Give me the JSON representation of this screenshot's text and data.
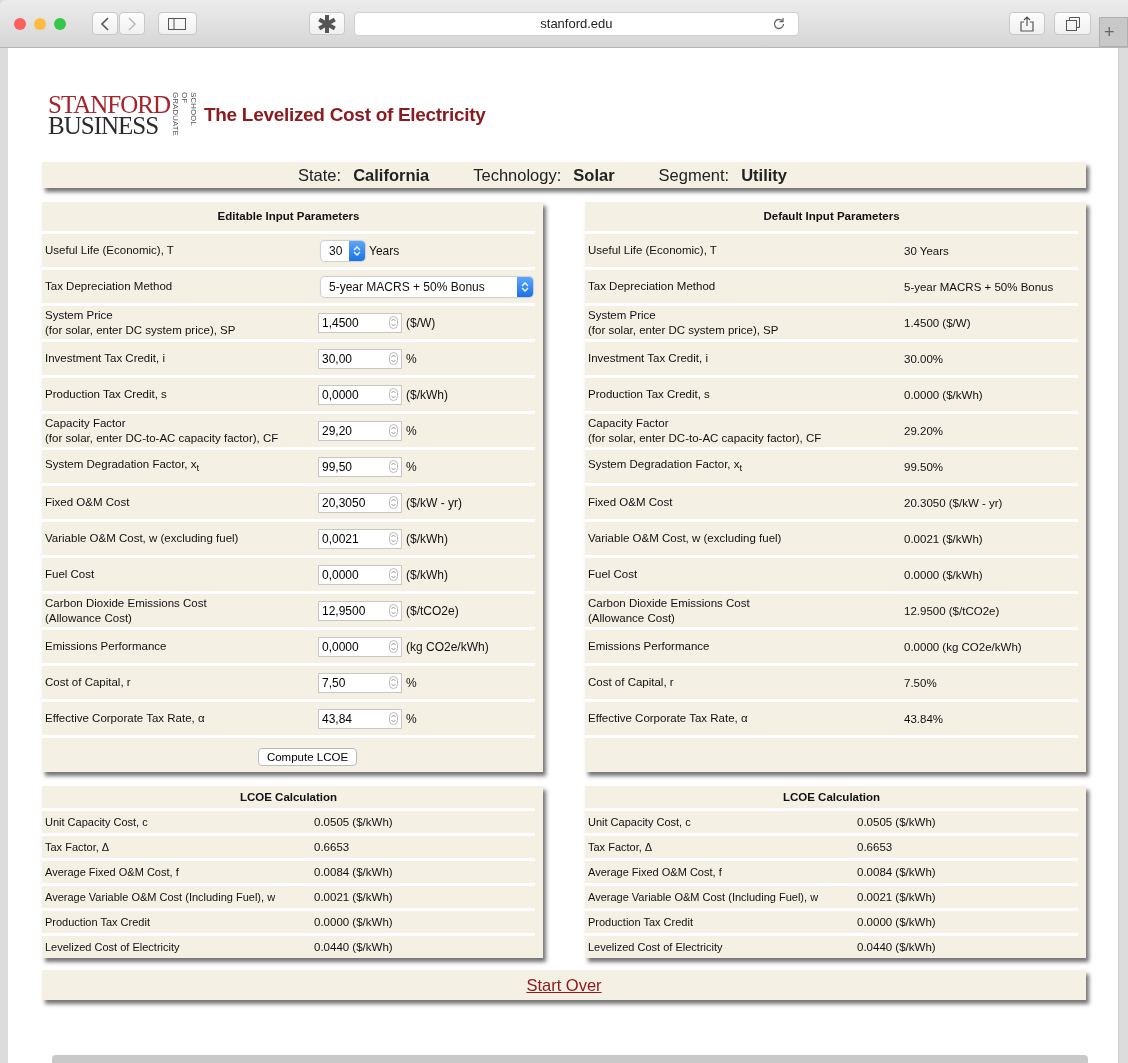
{
  "browser": {
    "url": "stanford.edu",
    "new_tab": "+"
  },
  "logo": {
    "line1": "STANFORD",
    "line2": "BUSINESS",
    "side1": "GRADUATE",
    "side2": "SCHOOL OF"
  },
  "title": "The Levelized Cost of Electricity",
  "selection": [
    {
      "label": "State:",
      "value": "California"
    },
    {
      "label": "Technology:",
      "value": "Solar"
    },
    {
      "label": "Segment:",
      "value": "Utility"
    }
  ],
  "editable": {
    "title": "Editable Input Parameters",
    "button": "Compute LCOE",
    "rows": [
      {
        "kind": "stepper-select",
        "label": "Useful Life (Economic), T",
        "value": "30",
        "unit": "Years"
      },
      {
        "kind": "dropdown",
        "label": "Tax Depreciation Method",
        "value": "5-year MACRS + 50% Bonus"
      },
      {
        "kind": "number",
        "label": "System Price",
        "sublabel": "(for solar, enter DC system price), SP",
        "value": "1,4500",
        "unit": "($/W)"
      },
      {
        "kind": "number",
        "label": "Investment Tax Credit, i",
        "value": "30,00",
        "unit": "%"
      },
      {
        "kind": "number",
        "label": "Production Tax Credit, s",
        "value": "0,0000",
        "unit": "($/kWh)"
      },
      {
        "kind": "number",
        "label": "Capacity Factor",
        "sublabel": "(for solar, enter DC-to-AC capacity factor), CF",
        "value": "29,20",
        "unit": "%"
      },
      {
        "kind": "number",
        "label": "System Degradation Factor, x$_{t}$",
        "value": "99,50",
        "unit": "%"
      },
      {
        "kind": "number",
        "label": "Fixed O&M Cost",
        "value": "20,3050",
        "unit": "($/kW - yr)"
      },
      {
        "kind": "number",
        "label": "Variable O&M Cost, w (excluding fuel)",
        "value": "0,0021",
        "unit": "($/kWh)"
      },
      {
        "kind": "number",
        "label": "Fuel Cost",
        "value": "0,0000",
        "unit": "($/kWh)"
      },
      {
        "kind": "number",
        "label": "Carbon Dioxide Emissions Cost",
        "sublabel": "(Allowance Cost)",
        "value": "12,9500",
        "unit": "($/tCO2e)"
      },
      {
        "kind": "number",
        "label": "Emissions Performance",
        "value": "0,0000",
        "unit": "(kg CO2e/kWh)"
      },
      {
        "kind": "number",
        "label": "Cost of Capital, r",
        "value": "7,50",
        "unit": "%"
      },
      {
        "kind": "number",
        "label": "Effective Corporate Tax Rate, α",
        "value": "43,84",
        "unit": "%"
      }
    ]
  },
  "defaults": {
    "title": "Default Input Parameters",
    "rows": [
      {
        "label": "Useful Life (Economic), T",
        "value": "30 Years"
      },
      {
        "label": "Tax Depreciation Method",
        "value": "5-year MACRS + 50% Bonus"
      },
      {
        "label": "System Price",
        "sublabel": "(for solar, enter DC system price), SP",
        "value": "1.4500 ($/W)"
      },
      {
        "label": "Investment Tax Credit, i",
        "value": "30.00%"
      },
      {
        "label": "Production Tax Credit, s",
        "value": "0.0000 ($/kWh)"
      },
      {
        "label": "Capacity Factor",
        "sublabel": "(for solar, enter DC-to-AC capacity factor), CF",
        "value": "29.20%"
      },
      {
        "label": "System Degradation Factor, x$_{t}$",
        "value": "99.50%"
      },
      {
        "label": "Fixed O&M Cost",
        "value": "20.3050 ($/kW - yr)"
      },
      {
        "label": "Variable O&M Cost, w (excluding fuel)",
        "value": "0.0021 ($/kWh)"
      },
      {
        "label": "Fuel Cost",
        "value": "0.0000 ($/kWh)"
      },
      {
        "label": "Carbon Dioxide Emissions Cost",
        "sublabel": "(Allowance Cost)",
        "value": "12.9500 ($/tCO2e)"
      },
      {
        "label": "Emissions Performance",
        "value": "0.0000 (kg CO2e/kWh)"
      },
      {
        "label": "Cost of Capital, r",
        "value": "7.50%"
      },
      {
        "label": "Effective Corporate Tax Rate, α",
        "value": "43.84%"
      }
    ]
  },
  "calculations": [
    {
      "title": "LCOE Calculation",
      "rows": [
        {
          "label": "Unit Capacity Cost, c",
          "value": "0.0505 ($/kWh)"
        },
        {
          "label": "Tax Factor, Δ",
          "value": "0.6653"
        },
        {
          "label": "Average Fixed O&M Cost, f",
          "value": "0.0084 ($/kWh)"
        },
        {
          "label": "Average Variable O&M Cost (Including Fuel), w",
          "value": "0.0021 ($/kWh)"
        },
        {
          "label": "Production Tax Credit",
          "value": "0.0000 ($/kWh)"
        },
        {
          "label": "Levelized Cost of Electricity",
          "value": "0.0440 ($/kWh)"
        }
      ]
    },
    {
      "title": "LCOE Calculation",
      "rows": [
        {
          "label": "Unit Capacity Cost, c",
          "value": "0.0505 ($/kWh)"
        },
        {
          "label": "Tax Factor, Δ",
          "value": "0.6653"
        },
        {
          "label": "Average Fixed O&M Cost, f",
          "value": "0.0084 ($/kWh)"
        },
        {
          "label": "Average Variable O&M Cost (Including Fuel), w",
          "value": "0.0021 ($/kWh)"
        },
        {
          "label": "Production Tax Credit",
          "value": "0.0000 ($/kWh)"
        },
        {
          "label": "Levelized Cost of Electricity",
          "value": "0.0440 ($/kWh)"
        }
      ]
    }
  ],
  "start_over": "Start Over"
}
